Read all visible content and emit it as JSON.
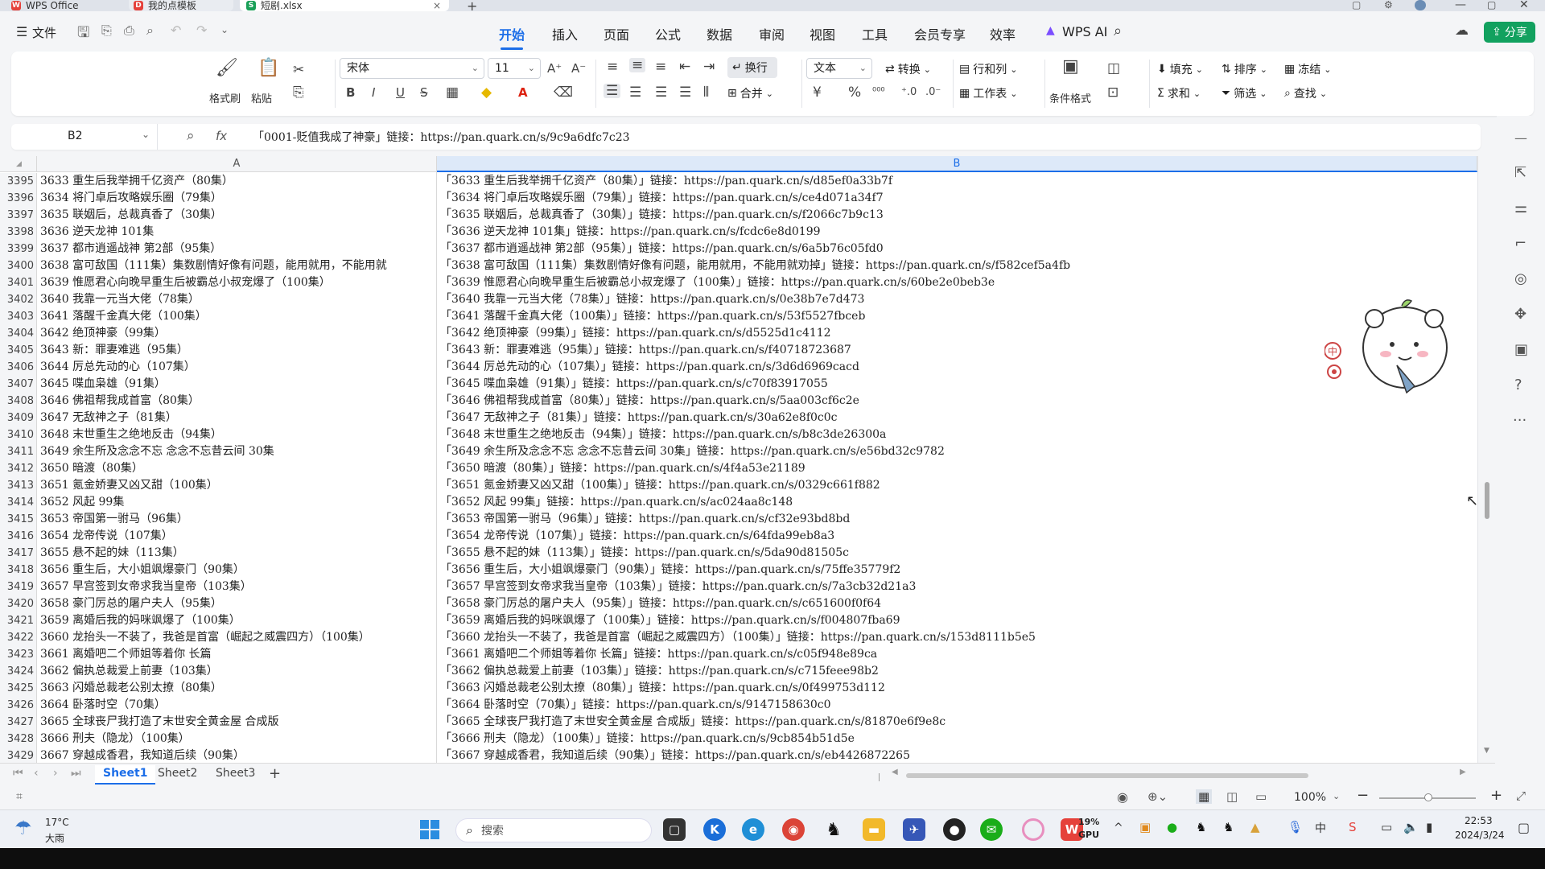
{
  "tabs": [
    {
      "label": "WPS Office",
      "badge": "W",
      "color": "#e5413b"
    },
    {
      "label": "我的点模板",
      "badge": "D",
      "color": "#e5413b"
    },
    {
      "label": "短剧.xlsx",
      "badge": "S",
      "color": "#1aa058"
    }
  ],
  "menubar": {
    "file": "文件",
    "items": [
      "开始",
      "插入",
      "页面",
      "公式",
      "数据",
      "审阅",
      "视图",
      "工具",
      "会员专享",
      "效率"
    ],
    "ai": "WPS AI",
    "share": "分享"
  },
  "ribbon": {
    "format_painter": "格式刷",
    "paste": "粘贴",
    "font": "宋体",
    "size": "11",
    "wrap": "换行",
    "merge": "合并",
    "numfmt": "文本",
    "convert": "转换",
    "rowcol": "行和列",
    "worksheet": "工作表",
    "condfmt": "条件格式",
    "fill": "填充",
    "sort": "排序",
    "freeze": "冻结",
    "sum": "求和",
    "filter": "筛选",
    "find": "查找"
  },
  "formula": {
    "cellref": "B2",
    "fx": "fx",
    "value": "「0001-贬值我成了神豪」链接：https://pan.quark.cn/s/9c9a6dfc7c23"
  },
  "grid": {
    "col_a": "A",
    "col_b": "B",
    "rows": [
      {
        "n": "3395",
        "a": "3633 重生后我举拥千亿资产（80集）",
        "b": "「3633 重生后我举拥千亿资产（80集）」链接：https://pan.quark.cn/s/d85ef0a33b7f"
      },
      {
        "n": "3396",
        "a": "3634 将门卓后攻略娱乐圈（79集）",
        "b": "「3634 将门卓后攻略娱乐圈（79集）」链接：https://pan.quark.cn/s/ce4d071a34f7"
      },
      {
        "n": "3397",
        "a": "3635 联姻后，总裁真香了（30集）",
        "b": "「3635 联姻后，总裁真香了（30集）」链接：https://pan.quark.cn/s/f2066c7b9c13"
      },
      {
        "n": "3398",
        "a": "3636 逆天龙神 101集",
        "b": "「3636 逆天龙神 101集」链接：https://pan.quark.cn/s/fcdc6e8d0199"
      },
      {
        "n": "3399",
        "a": "3637 都市逍遥战神 第2部（95集）",
        "b": "「3637 都市逍遥战神 第2部（95集）」链接：https://pan.quark.cn/s/6a5b76c05fd0"
      },
      {
        "n": "3400",
        "a": "3638 富可敌国（111集）集数剧情好像有问题，能用就用，不能用就",
        "b": "「3638 富可敌国（111集）集数剧情好像有问题，能用就用，不能用就劝掉」链接：https://pan.quark.cn/s/f582cef5a4fb"
      },
      {
        "n": "3401",
        "a": "3639 惟愿君心向晚早重生后被霸总小叔宠爆了（100集）",
        "b": "「3639 惟愿君心向晚早重生后被霸总小叔宠爆了（100集）」链接：https://pan.quark.cn/s/60be2e0beb3e"
      },
      {
        "n": "3402",
        "a": "3640 我靠一元当大佬（78集）",
        "b": "「3640 我靠一元当大佬（78集）」链接：https://pan.quark.cn/s/0e38b7e7d473"
      },
      {
        "n": "3403",
        "a": "3641 落醒千金真大佬（100集）",
        "b": "「3641 落醒千金真大佬（100集）」链接：https://pan.quark.cn/s/53f5527fbceb"
      },
      {
        "n": "3404",
        "a": "3642 绝顶神豪（99集）",
        "b": "「3642 绝顶神豪（99集）」链接：https://pan.quark.cn/s/d5525d1c4112"
      },
      {
        "n": "3405",
        "a": "3643 新：罪妻难逃（95集）",
        "b": "「3643 新：罪妻难逃（95集）」链接：https://pan.quark.cn/s/f40718723687"
      },
      {
        "n": "3406",
        "a": "3644 厉总先动的心（107集）",
        "b": "「3644 厉总先动的心（107集）」链接：https://pan.quark.cn/s/3d6d6969cacd"
      },
      {
        "n": "3407",
        "a": "3645 喋血枭雄（91集）",
        "b": "「3645 喋血枭雄（91集）」链接：https://pan.quark.cn/s/c70f83917055"
      },
      {
        "n": "3408",
        "a": "3646 佛祖帮我成首富（80集）",
        "b": "「3646 佛祖帮我成首富（80集）」链接：https://pan.quark.cn/s/5aa003cf6c2e"
      },
      {
        "n": "3409",
        "a": "3647 无敌神之子（81集）",
        "b": "「3647 无敌神之子（81集）」链接：https://pan.quark.cn/s/30a62e8f0c0c"
      },
      {
        "n": "3410",
        "a": "3648 末世重生之绝地反击（94集）",
        "b": "「3648 末世重生之绝地反击（94集）」链接：https://pan.quark.cn/s/b8c3de26300a"
      },
      {
        "n": "3411",
        "a": "3649 余生所及念念不忘 念念不忘昔云间 30集",
        "b": "「3649 余生所及念念不忘 念念不忘昔云间 30集」链接：https://pan.quark.cn/s/e56bd32c9782"
      },
      {
        "n": "3412",
        "a": "3650 暗渡（80集）",
        "b": "「3650 暗渡（80集）」链接：https://pan.quark.cn/s/4f4a53e21189"
      },
      {
        "n": "3413",
        "a": "3651 氪金娇妻又凶又甜（100集）",
        "b": "「3651 氪金娇妻又凶又甜（100集）」链接：https://pan.quark.cn/s/0329c661f882"
      },
      {
        "n": "3414",
        "a": "3652 风起 99集",
        "b": "「3652 风起 99集」链接：https://pan.quark.cn/s/ac024aa8c148"
      },
      {
        "n": "3415",
        "a": "3653 帝国第一驸马（96集）",
        "b": "「3653 帝国第一驸马（96集）」链接：https://pan.quark.cn/s/cf32e93bd8bd"
      },
      {
        "n": "3416",
        "a": "3654 龙帝传说（107集）",
        "b": "「3654 龙帝传说（107集）」链接：https://pan.quark.cn/s/64fda99eb8a3"
      },
      {
        "n": "3417",
        "a": "3655 悬不起的妹（113集）",
        "b": "「3655 悬不起的妹（113集）」链接：https://pan.quark.cn/s/5da90d81505c"
      },
      {
        "n": "3418",
        "a": "3656 重生后，大小姐飒爆豪门（90集）",
        "b": "「3656 重生后，大小姐飒爆豪门（90集）」链接：https://pan.quark.cn/s/75ffe35779f2"
      },
      {
        "n": "3419",
        "a": "3657 早宫签到女帝求我当皇帝（103集）",
        "b": "「3657 早宫签到女帝求我当皇帝（103集）」链接：https://pan.quark.cn/s/7a3cb32d21a3"
      },
      {
        "n": "3420",
        "a": "3658 豪门厉总的屠户夫人（95集）",
        "b": "「3658 豪门厉总的屠户夫人（95集）」链接：https://pan.quark.cn/s/c651600f0f64"
      },
      {
        "n": "3421",
        "a": "3659 离婚后我的妈咪飒爆了（100集）",
        "b": "「3659 离婚后我的妈咪飒爆了（100集）」链接：https://pan.quark.cn/s/f004807fba69"
      },
      {
        "n": "3422",
        "a": "3660 龙抬头一不装了，我爸是首富（崛起之威震四方）（100集）",
        "b": "「3660 龙抬头一不装了，我爸是首富（崛起之威震四方）（100集）」链接：https://pan.quark.cn/s/153d8111b5e5"
      },
      {
        "n": "3423",
        "a": "3661 离婚吧二个师姐等着你 长篇",
        "b": "「3661 离婚吧二个师姐等着你 长篇」链接：https://pan.quark.cn/s/c05f948e89ca"
      },
      {
        "n": "3424",
        "a": "3662 偏执总裁爱上前妻（103集）",
        "b": "「3662 偏执总裁爱上前妻（103集）」链接：https://pan.quark.cn/s/c715feee98b2"
      },
      {
        "n": "3425",
        "a": "3663 闪婚总裁老公别太撩（80集）",
        "b": "「3663 闪婚总裁老公别太撩（80集）」链接：https://pan.quark.cn/s/0f499753d112"
      },
      {
        "n": "3426",
        "a": "3664 卧落时空（70集）",
        "b": "「3664 卧落时空（70集）」链接：https://pan.quark.cn/s/9147158630c0"
      },
      {
        "n": "3427",
        "a": "3665 全球丧尸我打造了末世安全黄金屋 合成版",
        "b": "「3665 全球丧尸我打造了末世安全黄金屋 合成版」链接：https://pan.quark.cn/s/81870e6f9e8c"
      },
      {
        "n": "3428",
        "a": "3666 刑夫（隐龙）（100集）",
        "b": "「3666 刑夫（隐龙）（100集）」链接：https://pan.quark.cn/s/9cb854b51d5e"
      },
      {
        "n": "3429",
        "a": "3667 穿越成香君，我知道后续（90集）",
        "b": "「3667 穿越成香君，我知道后续（90集）」链接：https://pan.quark.cn/s/eb4426872265"
      }
    ]
  },
  "sheets": [
    "Sheet1",
    "Sheet2",
    "Sheet3"
  ],
  "status": {
    "zoom": "100%"
  },
  "taskbar": {
    "weather_temp": "17°C",
    "weather_desc": "大雨",
    "search": "搜索",
    "gpu_pct": "19%",
    "gpu_label": "GPU",
    "time": "22:53",
    "date": "2024/3/24"
  },
  "colors": {
    "accent": "#1c6ee8",
    "share_btn": "#12a15f",
    "excel_green": "#1aa058",
    "wps_red": "#e5413b"
  }
}
